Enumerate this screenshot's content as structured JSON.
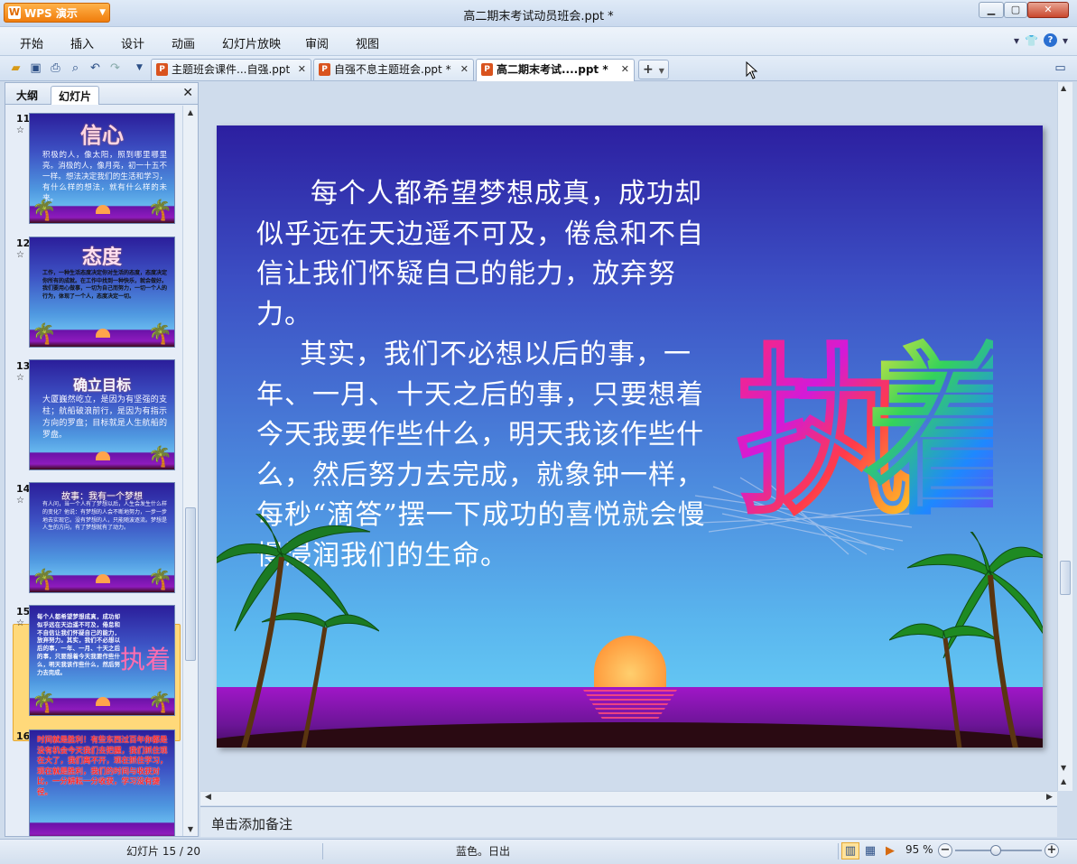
{
  "window": {
    "app_button": "WPS 演示",
    "title": "高二期末考试动员班会.ppt *"
  },
  "menu": {
    "items": [
      "开始",
      "插入",
      "设计",
      "动画",
      "幻灯片放映",
      "审阅",
      "视图"
    ]
  },
  "tabs": [
    {
      "label": "主题班会课件...自强.ppt",
      "active": false
    },
    {
      "label": "自强不息主题班会.ppt *",
      "active": false
    },
    {
      "label": "高二期末考试....ppt *",
      "active": true
    }
  ],
  "panel": {
    "tab_outline": "大纲",
    "tab_slides": "幻灯片"
  },
  "thumbnails": [
    {
      "number": "11",
      "title": "信心",
      "text": "积极的人，像太阳，照到哪里哪里亮。消极的人，像月亮，初一十五不一样。想法决定我们的生活和学习，有什么样的想法，就有什么样的未来。"
    },
    {
      "number": "12",
      "title": "态度",
      "text": "工作，一种生活态度决定你对生活的态度，态度决定你所有的成就。在工作中找到一种快乐，就会做好。我们要用心做事，一切为自己而努力，一切一个人的行为，体现了一个人，态度决定一切。"
    },
    {
      "number": "13",
      "title": "确立目标",
      "text": "大厦巍然屹立，是因为有坚强的支柱；航船破浪前行，是因为有指示方向的罗盘；目标就是人生航船的罗盘。"
    },
    {
      "number": "14",
      "title": "故事：我有一个梦想",
      "text": "有人问，当一个人有了梦想以后，人生会发生什么样的变化？他说：有梦想的人会不断地努力，一步一步地去实现它。没有梦想的人，只能随波逐流。梦想是人生的方向，有了梦想就有了动力。"
    },
    {
      "number": "15",
      "title": "执着",
      "text": "每个人都希望梦想成真，成功却似乎远在天边遥不可及，倦怠和不自信让我们怀疑自己的能力，放弃努力。其实，我们不必想以后的事，一年、一月、十天之后的事，只要想着今天我要作些什么，明天我该作些什么，然后努力去完成。"
    },
    {
      "number": "16",
      "title": "",
      "text": "时间就是胜利！有些东西过百年你都是没有机会今天我们去把握，我们抓住现在大了，我们离不开，现在抓住学习，现在就是胜利，我们的时间与收获对比，一分耕耘一分收获，学习没有捷径。"
    }
  ],
  "slide": {
    "paragraph1": "每个人都希望梦想成真，成功却似乎远在天边遥不可及，倦怠和不自信让我们怀疑自己的能力，放弃努力。",
    "paragraph2": "其实，我们不必想以后的事，一年、一月、十天之后的事，只要想着今天我要作些什么，明天我该作些什么，然后努力去完成，就象钟一样，每秒“滴答”摆一下成功的喜悦就会慢慢浸润我们的生命。",
    "word_art_char1": "执",
    "word_art_char2": "着"
  },
  "notes": {
    "placeholder": "单击添加备注"
  },
  "status": {
    "slide_counter": "幻灯片 15 / 20",
    "theme": "蓝色。日出",
    "zoom": "95 %"
  },
  "colors": {
    "accent": "#f07d0c",
    "selection": "#ffd97a",
    "slide_top": "#2c1fa0",
    "slide_bottom": "#63c5f3"
  }
}
